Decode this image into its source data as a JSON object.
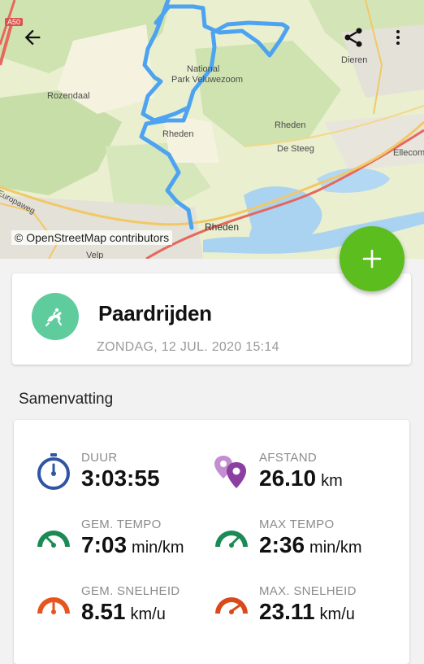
{
  "map": {
    "attribution": "© OpenStreetMap contributors",
    "labels": {
      "a50": "A50",
      "rozendaal": "Rozendaal",
      "national": "National",
      "park": "Park Veluwezoom",
      "rheden1": "Rheden",
      "rheden2": "Rheden",
      "desteeg": "De Steeg",
      "dieren": "Dieren",
      "ellecom": "Ellecom",
      "rheden3": "Rheden",
      "europaweg": "Europaweg",
      "velp": "Velp"
    }
  },
  "toolbar": {
    "back": "back-arrow-icon",
    "share": "share-icon",
    "more": "more-vert-icon"
  },
  "activity": {
    "title": "Paardrijden",
    "date": "ZONDAG, 12 JUL. 2020 15:14",
    "icon": "horse-riding-icon",
    "icon_bg": "#5ecc9c"
  },
  "summary": {
    "title": "Samenvatting",
    "metrics": [
      {
        "label": "DUUR",
        "value": "3:03:55",
        "unit": ""
      },
      {
        "label": "AFSTAND",
        "value": "26.10",
        "unit": "km"
      },
      {
        "label": "GEM. TEMPO",
        "value": "7:03",
        "unit": "min/km"
      },
      {
        "label": "MAX TEMPO",
        "value": "2:36",
        "unit": "min/km"
      },
      {
        "label": "GEM. SNELHEID",
        "value": "8.51",
        "unit": "km/u"
      },
      {
        "label": "MAX. SNELHEID",
        "value": "23.11",
        "unit": "km/u"
      }
    ]
  },
  "colors": {
    "fab": "#5bbd1e",
    "route": "#4da3f0",
    "duration": "#2f55a4",
    "distance": "#8b3fa0",
    "pace": "#1b8a55",
    "speed": "#e8541f"
  }
}
